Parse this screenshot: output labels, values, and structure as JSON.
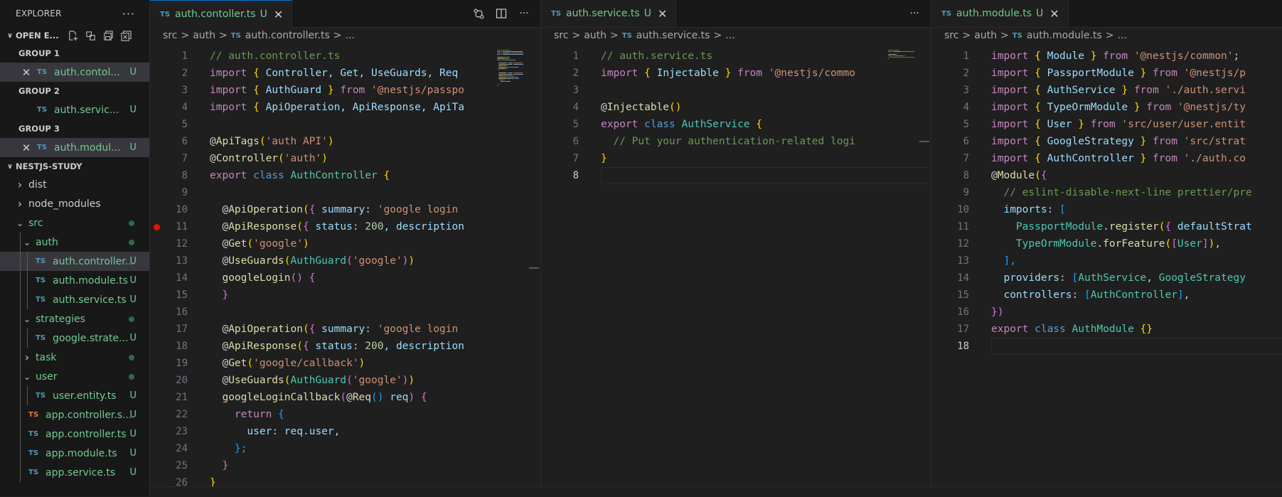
{
  "sidebar": {
    "title": "EXPLORER",
    "more": "···",
    "open_editors": {
      "label": "OPEN E...",
      "groups": [
        {
          "label": "GROUP 1",
          "file": "auth.contol...",
          "status": "U",
          "active": true
        },
        {
          "label": "GROUP 2",
          "file": "auth.servic...",
          "status": "U",
          "active": false
        },
        {
          "label": "GROUP 3",
          "file": "auth.modul...",
          "status": "U",
          "active": true
        }
      ]
    },
    "project": {
      "label": "NESTJS-STUDY",
      "items": [
        {
          "name": "dist",
          "type": "folder",
          "open": false,
          "depth": 0
        },
        {
          "name": "node_modules",
          "type": "folder",
          "open": false,
          "depth": 0
        },
        {
          "name": "src",
          "type": "folder",
          "open": true,
          "depth": 0,
          "dot": true
        },
        {
          "name": "auth",
          "type": "folder",
          "open": true,
          "depth": 1,
          "dot": true
        },
        {
          "name": "auth.controller...",
          "type": "file",
          "depth": 2,
          "status": "U",
          "selected": true
        },
        {
          "name": "auth.module.ts",
          "type": "file",
          "depth": 2,
          "status": "U"
        },
        {
          "name": "auth.service.ts",
          "type": "file",
          "depth": 2,
          "status": "U"
        },
        {
          "name": "strategies",
          "type": "folder",
          "open": true,
          "depth": 1,
          "dot": true
        },
        {
          "name": "google.strate...",
          "type": "file",
          "depth": 2,
          "status": "U"
        },
        {
          "name": "task",
          "type": "folder",
          "open": false,
          "depth": 1,
          "dot": true
        },
        {
          "name": "user",
          "type": "folder",
          "open": true,
          "depth": 1,
          "dot": true
        },
        {
          "name": "user.entity.ts",
          "type": "file",
          "depth": 2,
          "status": "U"
        },
        {
          "name": "app.controller.s...",
          "type": "file",
          "depth": 1,
          "status": "U",
          "orange": true
        },
        {
          "name": "app.controller.ts",
          "type": "file",
          "depth": 1,
          "status": "U"
        },
        {
          "name": "app.module.ts",
          "type": "file",
          "depth": 1,
          "status": "U"
        },
        {
          "name": "app.service.ts",
          "type": "file",
          "depth": 1,
          "status": "U"
        }
      ]
    }
  },
  "editors": [
    {
      "tab": {
        "icon": "TS",
        "name": "auth.contoller.ts",
        "status": "U"
      },
      "breadcrumb": [
        "src",
        "auth",
        "auth.controller.ts",
        "..."
      ],
      "current_line": 0,
      "breakpoint_line": 11,
      "lines": [
        [
          [
            "// auth.controller.ts",
            "c"
          ]
        ],
        [
          [
            "import",
            "k"
          ],
          [
            " ",
            "p"
          ],
          [
            "{",
            "y"
          ],
          [
            " Controller, Get, UseGuards, Req",
            "v"
          ]
        ],
        [
          [
            "import",
            "k"
          ],
          [
            " ",
            "p"
          ],
          [
            "{",
            "y"
          ],
          [
            " AuthGuard ",
            "v"
          ],
          [
            "}",
            "y"
          ],
          [
            " from ",
            "k"
          ],
          [
            "'@nestjs/passpo",
            "s"
          ]
        ],
        [
          [
            "import",
            "k"
          ],
          [
            " ",
            "p"
          ],
          [
            "{",
            "y"
          ],
          [
            " ApiOperation, ApiResponse, ApiTa",
            "v"
          ]
        ],
        [],
        [
          [
            "@",
            "p"
          ],
          [
            "ApiTags",
            "f"
          ],
          [
            "(",
            "y"
          ],
          [
            "'auth API'",
            "s"
          ],
          [
            ")",
            "y"
          ]
        ],
        [
          [
            "@",
            "p"
          ],
          [
            "Controller",
            "f"
          ],
          [
            "(",
            "y"
          ],
          [
            "'auth'",
            "s"
          ],
          [
            ")",
            "y"
          ]
        ],
        [
          [
            "export",
            "k"
          ],
          [
            " class ",
            "b"
          ],
          [
            "AuthController ",
            "t"
          ],
          [
            "{",
            "y"
          ]
        ],
        [],
        [
          [
            "  @",
            "p"
          ],
          [
            "ApiOperation",
            "f"
          ],
          [
            "(",
            "y"
          ],
          [
            "{",
            "m"
          ],
          [
            " summary",
            "v"
          ],
          [
            ": ",
            "p"
          ],
          [
            "'google login",
            "s"
          ]
        ],
        [
          [
            "  @",
            "p"
          ],
          [
            "ApiResponse",
            "f"
          ],
          [
            "(",
            "y"
          ],
          [
            "{",
            "m"
          ],
          [
            " status",
            "v"
          ],
          [
            ": ",
            "p"
          ],
          [
            "200",
            "n"
          ],
          [
            ", description",
            "v"
          ]
        ],
        [
          [
            "  @",
            "p"
          ],
          [
            "Get",
            "f"
          ],
          [
            "(",
            "y"
          ],
          [
            "'google'",
            "s"
          ],
          [
            ")",
            "y"
          ]
        ],
        [
          [
            "  @",
            "p"
          ],
          [
            "UseGuards",
            "f"
          ],
          [
            "(",
            "y"
          ],
          [
            "AuthGuard",
            "t"
          ],
          [
            "(",
            "m"
          ],
          [
            "'google'",
            "s"
          ],
          [
            ")",
            "m"
          ],
          [
            ")",
            "y"
          ]
        ],
        [
          [
            "  ",
            "p"
          ],
          [
            "googleLogin",
            "f"
          ],
          [
            "()",
            "m"
          ],
          [
            " ",
            "p"
          ],
          [
            "{",
            "m"
          ]
        ],
        [
          [
            "  ",
            "p"
          ],
          [
            "}",
            "m"
          ]
        ],
        [],
        [
          [
            "  @",
            "p"
          ],
          [
            "ApiOperation",
            "f"
          ],
          [
            "(",
            "y"
          ],
          [
            "{",
            "m"
          ],
          [
            " summary",
            "v"
          ],
          [
            ": ",
            "p"
          ],
          [
            "'google login",
            "s"
          ]
        ],
        [
          [
            "  @",
            "p"
          ],
          [
            "ApiResponse",
            "f"
          ],
          [
            "(",
            "y"
          ],
          [
            "{",
            "m"
          ],
          [
            " status",
            "v"
          ],
          [
            ": ",
            "p"
          ],
          [
            "200",
            "n"
          ],
          [
            ", description",
            "v"
          ]
        ],
        [
          [
            "  @",
            "p"
          ],
          [
            "Get",
            "f"
          ],
          [
            "(",
            "y"
          ],
          [
            "'google/callback'",
            "s"
          ],
          [
            ")",
            "y"
          ]
        ],
        [
          [
            "  @",
            "p"
          ],
          [
            "UseGuards",
            "f"
          ],
          [
            "(",
            "y"
          ],
          [
            "AuthGuard",
            "t"
          ],
          [
            "(",
            "m"
          ],
          [
            "'google'",
            "s"
          ],
          [
            ")",
            "m"
          ],
          [
            ")",
            "y"
          ]
        ],
        [
          [
            "  ",
            "p"
          ],
          [
            "googleLoginCallback",
            "f"
          ],
          [
            "(",
            "m"
          ],
          [
            "@",
            "p"
          ],
          [
            "Req",
            "f"
          ],
          [
            "()",
            "bl"
          ],
          [
            " req",
            "v"
          ],
          [
            ")",
            "m"
          ],
          [
            " ",
            "p"
          ],
          [
            "{",
            "m"
          ]
        ],
        [
          [
            "    ",
            "p"
          ],
          [
            "return",
            "k"
          ],
          [
            " ",
            "p"
          ],
          [
            "{",
            "bl"
          ]
        ],
        [
          [
            "      user",
            "v"
          ],
          [
            ": ",
            "p"
          ],
          [
            "req",
            "v"
          ],
          [
            ".",
            "p"
          ],
          [
            "user",
            "v"
          ],
          [
            ",",
            "p"
          ]
        ],
        [
          [
            "    ",
            "p"
          ],
          [
            "};",
            "bl"
          ]
        ],
        [
          [
            "  ",
            "p"
          ],
          [
            "}",
            "m"
          ]
        ],
        [
          [
            "}",
            "y"
          ]
        ]
      ]
    },
    {
      "tab": {
        "icon": "TS",
        "name": "auth.service.ts",
        "status": "U"
      },
      "breadcrumb": [
        "src",
        "auth",
        "auth.service.ts",
        "..."
      ],
      "current_line": 8,
      "lines": [
        [
          [
            "// auth.service.ts",
            "c"
          ]
        ],
        [
          [
            "import",
            "k"
          ],
          [
            " ",
            "p"
          ],
          [
            "{",
            "y"
          ],
          [
            " Injectable ",
            "v"
          ],
          [
            "}",
            "y"
          ],
          [
            " from ",
            "k"
          ],
          [
            "'@nestjs/commo",
            "s"
          ]
        ],
        [],
        [
          [
            "@",
            "p"
          ],
          [
            "Injectable",
            "f"
          ],
          [
            "()",
            "y"
          ]
        ],
        [
          [
            "export",
            "k"
          ],
          [
            " class ",
            "b"
          ],
          [
            "AuthService ",
            "t"
          ],
          [
            "{",
            "y"
          ]
        ],
        [
          [
            "  // Put your authentication-related logi",
            "c"
          ]
        ],
        [
          [
            "}",
            "y"
          ]
        ],
        []
      ]
    },
    {
      "tab": {
        "icon": "TS",
        "name": "auth.module.ts",
        "status": "U"
      },
      "breadcrumb": [
        "src",
        "auth",
        "auth.module.ts",
        "..."
      ],
      "current_line": 18,
      "lines": [
        [
          [
            "import",
            "k"
          ],
          [
            " ",
            "p"
          ],
          [
            "{",
            "y"
          ],
          [
            " Module ",
            "v"
          ],
          [
            "}",
            "y"
          ],
          [
            " from ",
            "k"
          ],
          [
            "'@nestjs/common'",
            "s"
          ],
          [
            ";",
            "p"
          ]
        ],
        [
          [
            "import",
            "k"
          ],
          [
            " ",
            "p"
          ],
          [
            "{",
            "y"
          ],
          [
            " PassportModule ",
            "v"
          ],
          [
            "}",
            "y"
          ],
          [
            " from ",
            "k"
          ],
          [
            "'@nestjs/p",
            "s"
          ]
        ],
        [
          [
            "import",
            "k"
          ],
          [
            " ",
            "p"
          ],
          [
            "{",
            "y"
          ],
          [
            " AuthService ",
            "v"
          ],
          [
            "}",
            "y"
          ],
          [
            " from ",
            "k"
          ],
          [
            "'./auth.servi",
            "s"
          ]
        ],
        [
          [
            "import",
            "k"
          ],
          [
            " ",
            "p"
          ],
          [
            "{",
            "y"
          ],
          [
            " TypeOrmModule ",
            "v"
          ],
          [
            "}",
            "y"
          ],
          [
            " from ",
            "k"
          ],
          [
            "'@nestjs/ty",
            "s"
          ]
        ],
        [
          [
            "import",
            "k"
          ],
          [
            " ",
            "p"
          ],
          [
            "{",
            "y"
          ],
          [
            " User ",
            "v"
          ],
          [
            "}",
            "y"
          ],
          [
            " from ",
            "k"
          ],
          [
            "'src/user/user.entit",
            "s"
          ]
        ],
        [
          [
            "import",
            "k"
          ],
          [
            " ",
            "p"
          ],
          [
            "{",
            "y"
          ],
          [
            " GoogleStrategy ",
            "v"
          ],
          [
            "}",
            "y"
          ],
          [
            " from ",
            "k"
          ],
          [
            "'src/strat",
            "s"
          ]
        ],
        [
          [
            "import",
            "k"
          ],
          [
            " ",
            "p"
          ],
          [
            "{",
            "y"
          ],
          [
            " AuthController ",
            "v"
          ],
          [
            "}",
            "y"
          ],
          [
            " from ",
            "k"
          ],
          [
            "'./auth.co",
            "s"
          ]
        ],
        [
          [
            "@",
            "p"
          ],
          [
            "Module",
            "f"
          ],
          [
            "(",
            "y"
          ],
          [
            "{",
            "m"
          ]
        ],
        [
          [
            "  // eslint-disable-next-line prettier/pre",
            "c"
          ]
        ],
        [
          [
            "  imports",
            "v"
          ],
          [
            ": ",
            "p"
          ],
          [
            "[",
            "bl"
          ]
        ],
        [
          [
            "    PassportModule",
            "t"
          ],
          [
            ".",
            "p"
          ],
          [
            "register",
            "f"
          ],
          [
            "(",
            "y"
          ],
          [
            "{",
            "m"
          ],
          [
            " defaultStrat",
            "v"
          ]
        ],
        [
          [
            "    TypeOrmModule",
            "t"
          ],
          [
            ".",
            "p"
          ],
          [
            "forFeature",
            "f"
          ],
          [
            "(",
            "y"
          ],
          [
            "[",
            "m"
          ],
          [
            "User",
            "t"
          ],
          [
            "]",
            "m"
          ],
          [
            ")",
            "y"
          ],
          [
            ",",
            "p"
          ]
        ],
        [
          [
            "  ",
            "p"
          ],
          [
            "],",
            "bl"
          ]
        ],
        [
          [
            "  providers",
            "v"
          ],
          [
            ": ",
            "p"
          ],
          [
            "[",
            "bl"
          ],
          [
            "AuthService",
            "t"
          ],
          [
            ", ",
            "p"
          ],
          [
            "GoogleStrategy",
            "t"
          ]
        ],
        [
          [
            "  controllers",
            "v"
          ],
          [
            ": ",
            "p"
          ],
          [
            "[",
            "bl"
          ],
          [
            "AuthController",
            "t"
          ],
          [
            "]",
            "bl"
          ],
          [
            ",",
            "p"
          ]
        ],
        [
          [
            "})",
            "m"
          ]
        ],
        [
          [
            "export",
            "k"
          ],
          [
            " class ",
            "b"
          ],
          [
            "AuthModule ",
            "t"
          ],
          [
            "{}",
            "y"
          ]
        ],
        []
      ]
    }
  ]
}
